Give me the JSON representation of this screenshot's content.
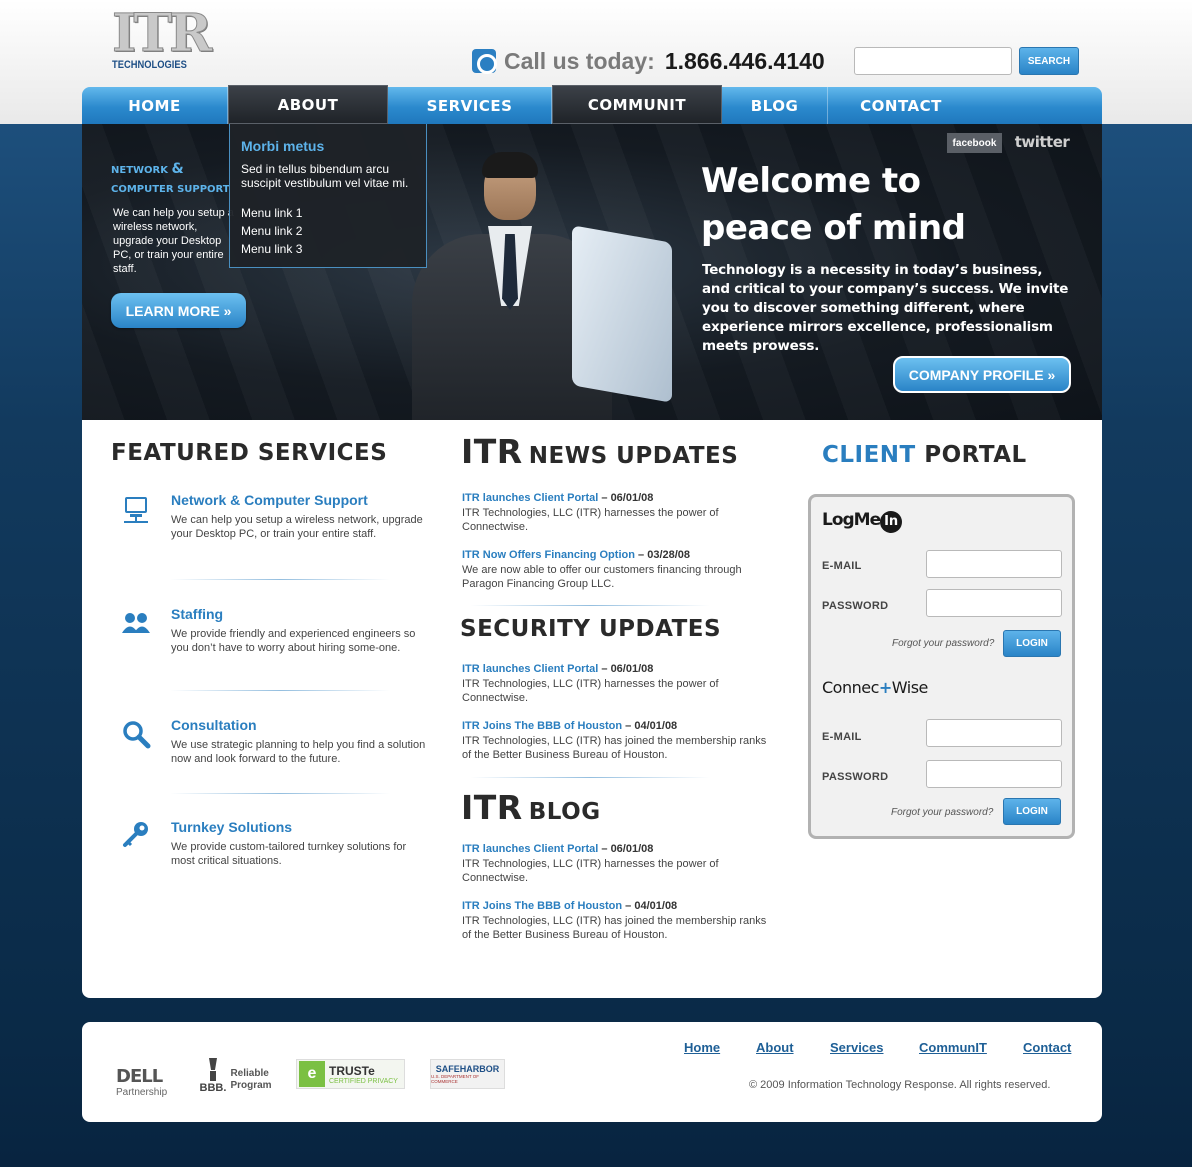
{
  "header": {
    "logo_text": "ITR",
    "logo_sub": "TECHNOLOGIES",
    "call_label": "Call us today:",
    "phone": "1.866.446.4140",
    "search_button": "SEARCH",
    "search_value": ""
  },
  "nav": [
    {
      "label": "HOME"
    },
    {
      "label": "ABOUT"
    },
    {
      "label": "SERVICES"
    },
    {
      "label": "COMMUNIT"
    },
    {
      "label": "BLOG"
    },
    {
      "label": "CONTACT"
    }
  ],
  "dropdown": {
    "title": "Morbi metus",
    "text": "Sed in tellus bibendum arcu suscipit vestibulum vel vitae mi.",
    "links": [
      "Menu link 1",
      "Menu link 2",
      "Menu link 3"
    ]
  },
  "hero": {
    "side_title_line1": "NETWORK",
    "side_amp": "&",
    "side_title_line2": "COMPUTER SUPPORT",
    "side_text": "We can help you setup a wireless network, upgrade your Desktop PC, or train your entire staff.",
    "learn_more": "LEARN MORE »",
    "facebook": "facebook",
    "twitter": "twitter",
    "title_line1": "Welcome to",
    "title_line2": "peace of mind",
    "text": "Technology is a necessity in today’s business, and critical to your company’s success. We invite you to discover something different, where experience mirrors excellence, professionalism meets prowess.",
    "company_profile": "COMPANY PROFILE »"
  },
  "featured": {
    "title": "FEATURED SERVICES",
    "items": [
      {
        "icon": "computer-icon",
        "title": "Network & Computer Support",
        "desc": "We can help you setup a wireless network, upgrade your Desktop PC, or train your entire staff."
      },
      {
        "icon": "users-icon",
        "title": "Staffing",
        "desc": "We provide friendly and experienced engineers so you don’t have to worry about hiring some-one."
      },
      {
        "icon": "magnifier-icon",
        "title": "Consultation",
        "desc": "We use strategic planning to help you find a solution now and look forward to the future."
      },
      {
        "icon": "key-icon",
        "title": "Turnkey Solutions",
        "desc": "We provide custom-tailored turnkey solutions for most critical situations."
      }
    ]
  },
  "news": {
    "title_itr": "ITR",
    "title_rest": "NEWS UPDATES",
    "items": [
      {
        "title": "ITR launches Client Portal",
        "date": "06/01/08",
        "desc": "ITR Technologies, LLC (ITR) harnesses the power of Connectwise."
      },
      {
        "title": "ITR Now Offers Financing Option",
        "date": "03/28/08",
        "desc": "We are now able to offer our customers financing through Paragon Financing Group LLC."
      }
    ]
  },
  "security": {
    "title": "SECURITY UPDATES",
    "items": [
      {
        "title": "ITR launches Client Portal",
        "date": "06/01/08",
        "desc": "ITR Technologies, LLC (ITR) harnesses the power of Connectwise."
      },
      {
        "title": "ITR Joins The BBB of Houston",
        "date": "04/01/08",
        "desc": "ITR Technologies, LLC (ITR) has joined the membership ranks of the Better Business Bureau of Houston."
      }
    ]
  },
  "blog": {
    "title_itr": "ITR",
    "title_rest": "BLOG",
    "items": [
      {
        "title": "ITR launches Client Portal",
        "date": "06/01/08",
        "desc": "ITR Technologies, LLC (ITR) harnesses the power of Connectwise."
      },
      {
        "title": "ITR Joins The BBB of Houston",
        "date": "04/01/08",
        "desc": "ITR Technologies, LLC (ITR) has joined the membership ranks of the Better Business Bureau of Houston."
      }
    ]
  },
  "portal": {
    "title_client": "CLIENT",
    "title_portal": "PORTAL",
    "logmein_text": "LogMe",
    "logmein_in": "In",
    "connectwise_a": "Connec",
    "connectwise_plus": "+",
    "connectwise_b": "Wise",
    "email_label": "E-MAIL",
    "password_label": "PASSWORD",
    "forgot": "Forgot your password?",
    "login": "LOGIN"
  },
  "footer": {
    "dell": "DELL",
    "dell_sub": "Partnership",
    "bbb": "BBB.",
    "bbb_text": "Reliable Program",
    "truste": "TRUSTe",
    "truste_sub": "CERTIFIED PRIVACY",
    "safeharbor": "SAFEHARBOR",
    "safeharbor_sub": "U.S. DEPARTMENT OF COMMERCE",
    "links": [
      "Home",
      "About",
      "Services",
      "CommunIT",
      "Contact"
    ],
    "copyright": "© 2009 Information Technology Response. All rights reserved."
  },
  "colors": {
    "accent": "#2a7ebf",
    "nav_blue": "#2b89cd",
    "dark_bg": "#0a2d4a"
  }
}
